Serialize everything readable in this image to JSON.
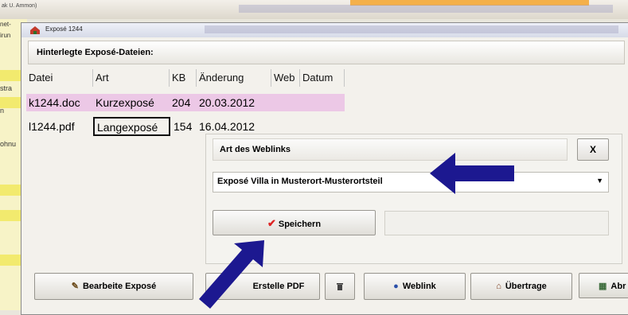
{
  "background": {
    "menu_text": "ak U. Ammon)",
    "left_labels": [
      "net-",
      "irun",
      "stra",
      "n",
      "ohnu"
    ]
  },
  "window": {
    "title": "Exposé 1244",
    "section_label": "Hinterlegte Exposé-Dateien:"
  },
  "table": {
    "headers": [
      "Datei",
      "Art",
      "KB",
      "Änderung",
      "Web",
      "Datum"
    ],
    "rows": [
      {
        "datei": "k1244.doc",
        "art": "Kurzexposé",
        "kb": "204",
        "aenderung": "20.03.2012",
        "web": "",
        "datum": ""
      },
      {
        "datei": "l1244.pdf",
        "art": "Langexposé",
        "kb": "154",
        "aenderung": "16.04.2012",
        "web": "",
        "datum": ""
      }
    ]
  },
  "dialog": {
    "title": "Art des Weblinks",
    "close_label": "X",
    "combo_value": "Exposé Villa in Musterort-Musterortsteil",
    "save_label": "Speichern",
    "save_icon": "check-icon"
  },
  "toolbar": {
    "edit_label": "Bearbeite Exposé",
    "pdf_label": "Erstelle PDF",
    "weblink_label": "Weblink",
    "transfer_label": "Übertrage",
    "last_label": "Abr"
  },
  "colors": {
    "highlight_row": "#ecc8e6",
    "arrow": "#1c1890",
    "yellow_strip": "#f2ea6e"
  }
}
